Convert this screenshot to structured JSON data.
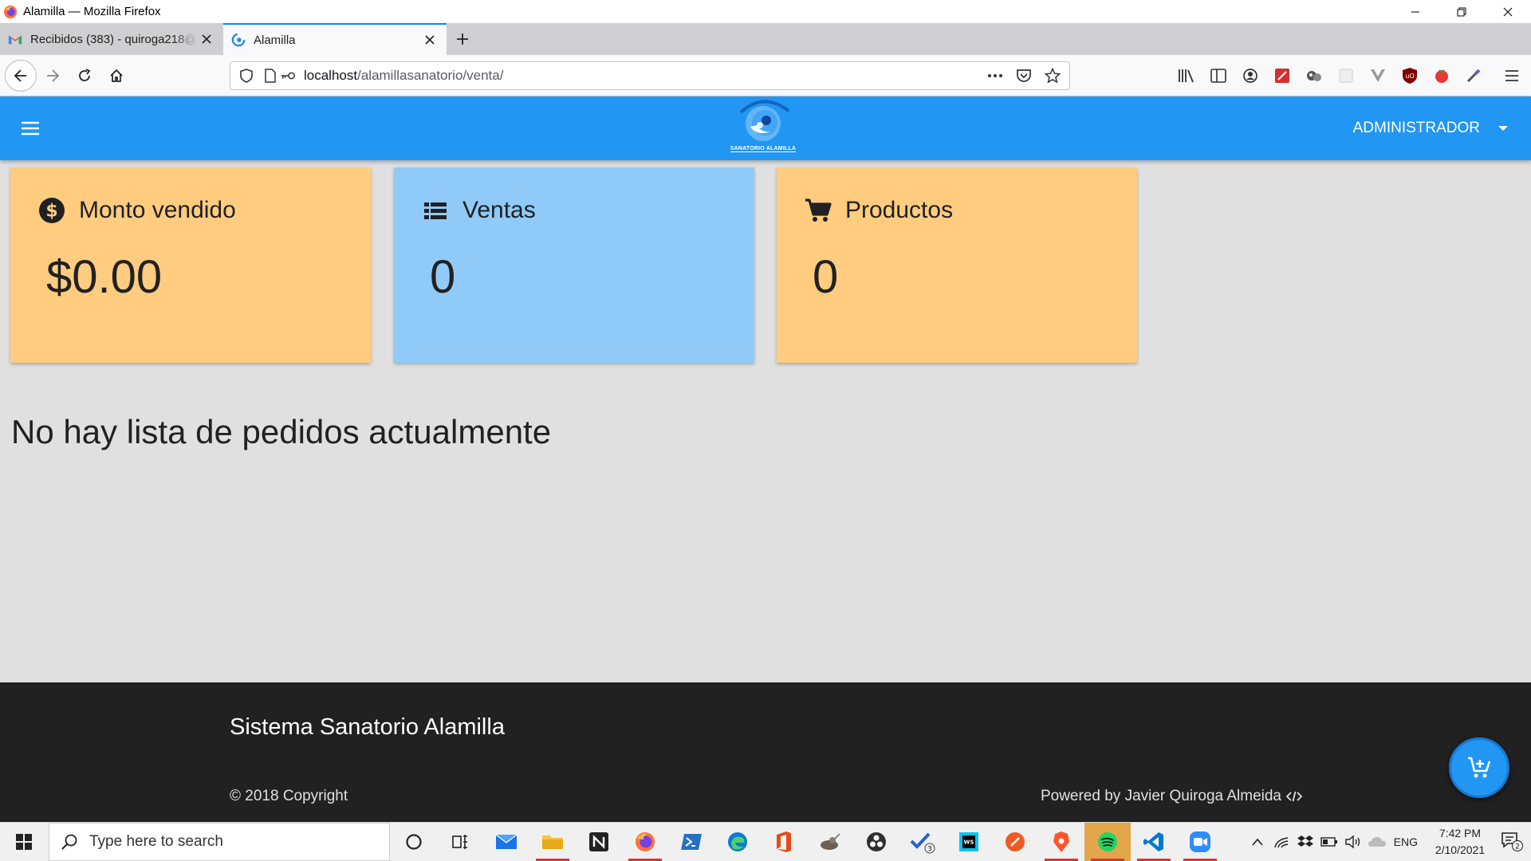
{
  "window": {
    "title": "Alamilla — Mozilla Firefox"
  },
  "tabs": [
    {
      "label": "Recibidos (383) - quiroga218@",
      "active": false,
      "favicon": "gmail-icon"
    },
    {
      "label": "Alamilla",
      "active": true,
      "favicon": "sanatorio-logo-icon"
    }
  ],
  "address_bar": {
    "host": "localhost",
    "path": "/alamillasanatorio/venta/"
  },
  "app": {
    "brand": "SANATORIO ALAMILLA",
    "user": "ADMINISTRADOR",
    "colors": {
      "primary": "#2196f3",
      "card_orange": "#ffcc80",
      "card_blue": "#90caf9",
      "footer": "#212121"
    }
  },
  "cards": [
    {
      "title": "Monto vendido",
      "value": "$0.00",
      "icon": "dollar-icon"
    },
    {
      "title": "Ventas",
      "value": "0",
      "icon": "list-icon"
    },
    {
      "title": "Productos",
      "value": "0",
      "icon": "cart-icon"
    }
  ],
  "empty_message": "No hay lista de pedidos actualmente",
  "footer": {
    "title": "Sistema Sanatorio Alamilla",
    "copyright": "© 2018 Copyright",
    "powered_by": "Powered by Javier Quiroga Almeida"
  },
  "taskbar": {
    "search_placeholder": "Type here to search",
    "language": "ENG",
    "time": "7:42 PM",
    "date": "2/10/2021",
    "todo_badge": "3",
    "notification_badge": "2"
  }
}
